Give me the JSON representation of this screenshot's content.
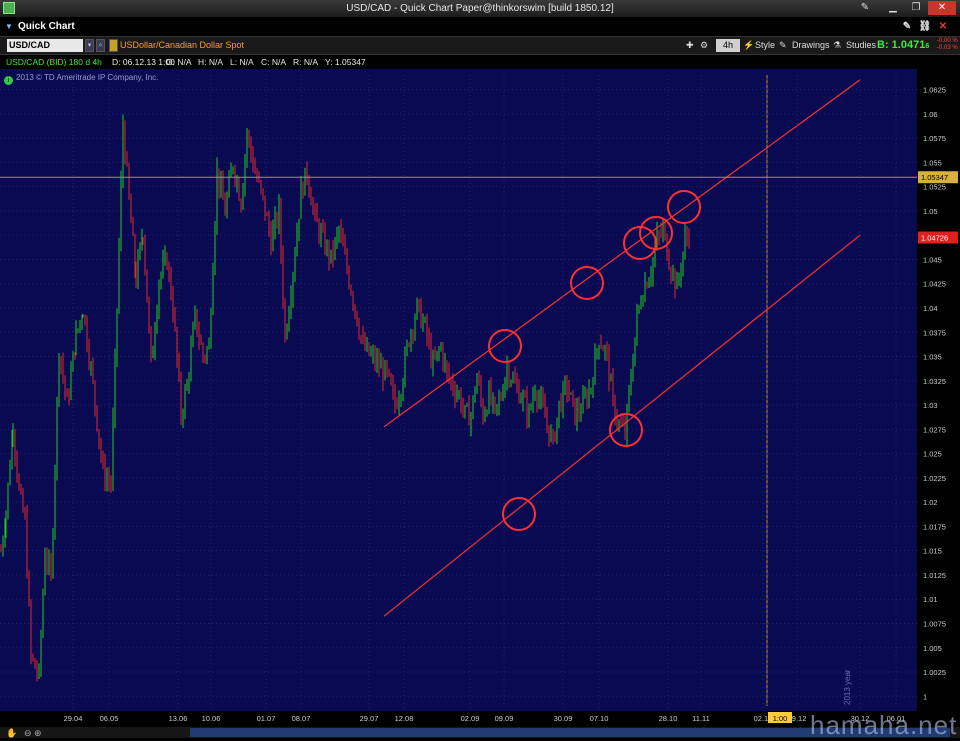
{
  "window": {
    "title": "USD/CAD - Quick Chart Paper@thinkorswim [build 1850.12]"
  },
  "app_bar": {
    "label": "Quick Chart"
  },
  "toolbar": {
    "symbol": "USD/CAD",
    "description": "USDollar/Canadian Dollar Spot",
    "timeframe": "4h",
    "style_label": "Style",
    "drawings_label": "Drawings",
    "studies_label": "Studies",
    "bid_text": "B: 1.0471",
    "bid_suffix": "6",
    "net_change": "-0.00 %",
    "net_change2": "-0.03 %"
  },
  "info_bar": {
    "study_label": "USD/CAD (BID) 180 d 4h",
    "date": "D: 06.12.13 1:00",
    "open": "O: N/A",
    "high": "H: N/A",
    "low": "L: N/A",
    "close": "C: N/A",
    "range": "R: N/A",
    "y": "Y: 1.05347"
  },
  "copyright": "2013 © TD Ameritrade IP Company, Inc.",
  "watermark": "hamaha.net",
  "colors": {
    "background": "#0a0a52",
    "up": "#1ecc1e",
    "down": "#e02a2a",
    "trendline": "#ff3030",
    "crosshair": "#cc8a22",
    "grid": "#3a3a8a"
  },
  "chart_data": {
    "type": "candlestick",
    "instrument": "USD/CAD (BID)",
    "period": "180 d",
    "interval": "4h",
    "ylim": [
      0.999,
      1.064
    ],
    "y_ticks": [
      "1.0625",
      "1.06",
      "1.0575",
      "1.055",
      "1.0525",
      "1.05",
      "1.0475",
      "1.045",
      "1.0425",
      "1.04",
      "1.0375",
      "1.035",
      "1.0325",
      "1.03",
      "1.0275",
      "1.025",
      "1.0225",
      "1.02",
      "1.0175",
      "1.015",
      "1.0125",
      "1.01",
      "1.0075",
      "1.005",
      "1.0025",
      "1"
    ],
    "x_ticks": [
      "29.04",
      "06.05",
      "13.06",
      "10.06",
      "01.07",
      "08.07",
      "29.07",
      "12.08",
      "02.09",
      "09.09",
      "30.09",
      "07.10",
      "28.10",
      "11.11",
      "02.12",
      "09.12",
      "30.12",
      "06.01"
    ],
    "path": [
      [
        0,
        1.015
      ],
      [
        5,
        1.019
      ],
      [
        12,
        1.028
      ],
      [
        18,
        1.021
      ],
      [
        24,
        1.018
      ],
      [
        30,
        1.004
      ],
      [
        38,
        1.002
      ],
      [
        44,
        1.015
      ],
      [
        50,
        1.012
      ],
      [
        58,
        1.036
      ],
      [
        66,
        1.03
      ],
      [
        75,
        1.037
      ],
      [
        82,
        1.04
      ],
      [
        92,
        1.032
      ],
      [
        102,
        1.023
      ],
      [
        110,
        1.022
      ],
      [
        116,
        1.04
      ],
      [
        122,
        1.059
      ],
      [
        128,
        1.051
      ],
      [
        135,
        1.043
      ],
      [
        142,
        1.048
      ],
      [
        150,
        1.034
      ],
      [
        158,
        1.043
      ],
      [
        166,
        1.045
      ],
      [
        172,
        1.04
      ],
      [
        180,
        1.029
      ],
      [
        186,
        1.032
      ],
      [
        194,
        1.039
      ],
      [
        202,
        1.035
      ],
      [
        208,
        1.036
      ],
      [
        216,
        1.054
      ],
      [
        224,
        1.05
      ],
      [
        232,
        1.055
      ],
      [
        240,
        1.051
      ],
      [
        246,
        1.058
      ],
      [
        254,
        1.054
      ],
      [
        262,
        1.051
      ],
      [
        270,
        1.047
      ],
      [
        278,
        1.05
      ],
      [
        284,
        1.037
      ],
      [
        292,
        1.044
      ],
      [
        300,
        1.052
      ],
      [
        306,
        1.054
      ],
      [
        314,
        1.049
      ],
      [
        322,
        1.047
      ],
      [
        330,
        1.045
      ],
      [
        338,
        1.048
      ],
      [
        346,
        1.044
      ],
      [
        354,
        1.04
      ],
      [
        362,
        1.036
      ],
      [
        370,
        1.035
      ],
      [
        378,
        1.034
      ],
      [
        386,
        1.033
      ],
      [
        394,
        1.03
      ],
      [
        400,
        1.032
      ],
      [
        408,
        1.037
      ],
      [
        416,
        1.04
      ],
      [
        424,
        1.038
      ],
      [
        432,
        1.034
      ],
      [
        440,
        1.036
      ],
      [
        446,
        1.033
      ],
      [
        452,
        1.032
      ],
      [
        458,
        1.031
      ],
      [
        464,
        1.029
      ],
      [
        470,
        1.029
      ],
      [
        476,
        1.033
      ],
      [
        482,
        1.029
      ],
      [
        488,
        1.031
      ],
      [
        494,
        1.029
      ],
      [
        500,
        1.031
      ],
      [
        506,
        1.034
      ],
      [
        514,
        1.032
      ],
      [
        520,
        1.031
      ],
      [
        528,
        1.029
      ],
      [
        534,
        1.032
      ],
      [
        540,
        1.03
      ],
      [
        546,
        1.028
      ],
      [
        552,
        1.026
      ],
      [
        558,
        1.03
      ],
      [
        566,
        1.032
      ],
      [
        574,
        1.029
      ],
      [
        582,
        1.03
      ],
      [
        590,
        1.032
      ],
      [
        598,
        1.037
      ],
      [
        606,
        1.035
      ],
      [
        612,
        1.03
      ],
      [
        618,
        1.028
      ],
      [
        624,
        1.027
      ],
      [
        630,
        1.033
      ],
      [
        636,
        1.039
      ],
      [
        642,
        1.042
      ],
      [
        650,
        1.044
      ],
      [
        656,
        1.047
      ],
      [
        662,
        1.048
      ],
      [
        668,
        1.045
      ],
      [
        676,
        1.042
      ],
      [
        684,
        1.047
      ],
      [
        690,
        1.048
      ]
    ],
    "trendlines": [
      {
        "from": [
          "29.07",
          1.02775
        ],
        "to": [
          "30.12",
          1.0635
        ]
      },
      {
        "from": [
          "29.07",
          1.00825
        ],
        "to": [
          "30.12",
          1.0475
        ]
      }
    ],
    "highlight_circles": [
      {
        "x": "02.09",
        "y": 1.0355
      },
      {
        "x": "09.09",
        "y": 1.0185
      },
      {
        "x": "07.10",
        "y": 1.0415
      },
      {
        "x": "28.10",
        "y": 1.0465
      },
      {
        "x": "28.10",
        "y": 1.0475
      },
      {
        "x": "28.10",
        "y": 1.0495
      },
      {
        "x": "07.10",
        "y": 1.027
      }
    ],
    "price_labels": [
      {
        "value": "1.05347",
        "color": "crosshair"
      },
      {
        "value": "1.04726",
        "color": "last"
      }
    ],
    "crosshair": {
      "price": 1.05347,
      "time": "1:00"
    },
    "vertical_marker": "2013 year",
    "grid": true
  }
}
